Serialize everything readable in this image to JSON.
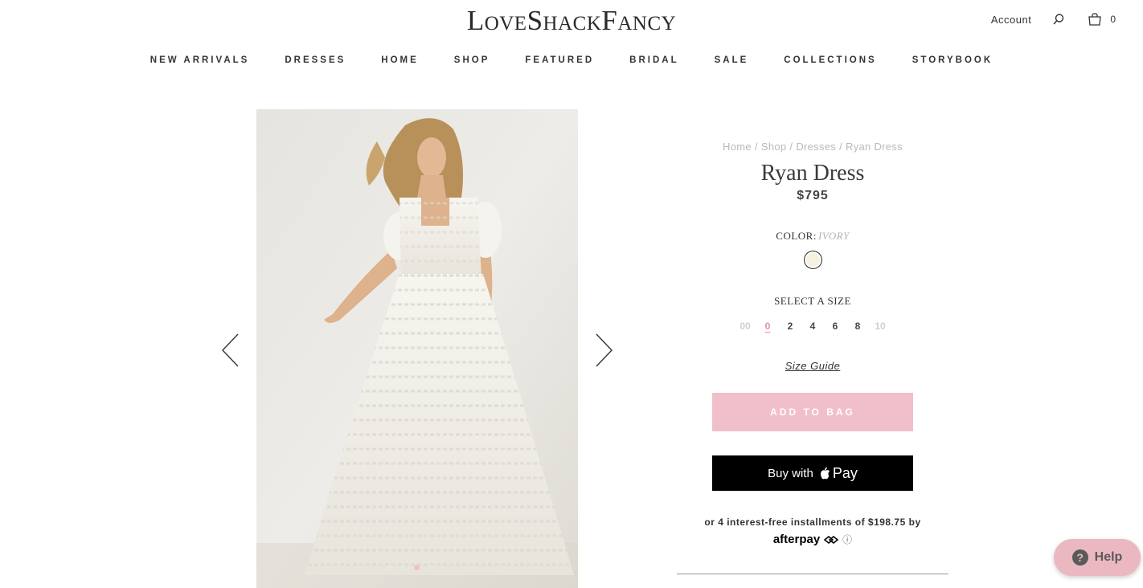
{
  "header": {
    "logo": "LoveShackFancy",
    "account_label": "Account",
    "search_icon": "search-icon",
    "bag_icon": "shopping-bag-icon",
    "bag_count": "0"
  },
  "nav": [
    "NEW ARRIVALS",
    "DRESSES",
    "HOME",
    "SHOP",
    "FEATURED",
    "BRIDAL",
    "SALE",
    "COLLECTIONS",
    "STORYBOOK"
  ],
  "gallery": {
    "prev_icon": "chevron-left-icon",
    "next_icon": "chevron-right-icon",
    "dot_count": 4,
    "active_dot": 2
  },
  "breadcrumb": [
    "Home",
    "Shop",
    "Dresses",
    "Ryan Dress"
  ],
  "product": {
    "title": "Ryan Dress",
    "price": "$795",
    "color_label": "COLOR:",
    "color_value": "IVORY",
    "swatch_color": "#f6f1df",
    "size_label": "SELECT A SIZE",
    "sizes": [
      {
        "label": "00",
        "state": "disabled"
      },
      {
        "label": "0",
        "state": "selected"
      },
      {
        "label": "2",
        "state": "available"
      },
      {
        "label": "4",
        "state": "available"
      },
      {
        "label": "6",
        "state": "available"
      },
      {
        "label": "8",
        "state": "available"
      },
      {
        "label": "10",
        "state": "disabled"
      }
    ],
    "size_guide": "Size Guide",
    "add_to_bag": "ADD TO BAG",
    "apple_pay_prefix": "Buy with",
    "apple_pay_word": "Pay",
    "installments": "or 4 interest-free installments of $198.75 by",
    "afterpay": "afterpay"
  },
  "help": {
    "label": "Help"
  },
  "colors": {
    "accent_pink": "#f1bfca",
    "help_pink": "#ebb8c1",
    "selected_size": "#e8909e"
  }
}
